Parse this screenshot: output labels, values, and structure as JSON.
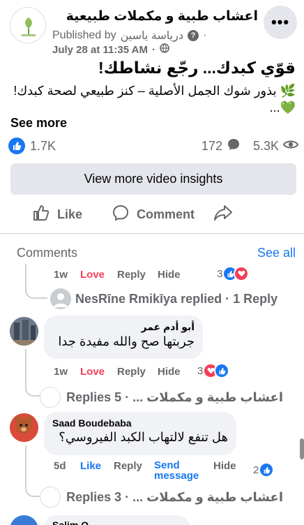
{
  "post": {
    "page_name": "اعشاب طبية و مكملات طبيعية",
    "published_by_label": "Published by",
    "published_by_name": "درياسة ياسين",
    "date": "July 28 at 11:35 AM",
    "title": "قوّي كبدك... رجّع نشاطك!",
    "body": "🌿 بذور شوك الجمل الأصلية – كنز طبيعي لصحة كبدك! 💚...",
    "see_more": "See more"
  },
  "stats": {
    "reactions": "1.7K",
    "comments": "172",
    "views": "5.3K"
  },
  "insights_button": "View more video insights",
  "actions": {
    "like": "Like",
    "comment": "Comment"
  },
  "comments_header": {
    "label": "Comments",
    "see_all": "See all"
  },
  "comments": [
    {
      "time": "1w",
      "reaction_label": "Love",
      "reply": "Reply",
      "hide": "Hide",
      "reaction_count": "3",
      "reply_by": "NesRīne Rmikīya replied · 1 Reply"
    },
    {
      "author": "أبو أدم عمر",
      "text": "جربتها صح والله مفيدة جدا",
      "time": "1w",
      "reaction_label": "Love",
      "reply": "Reply",
      "hide": "Hide",
      "reaction_count": "3",
      "replies": "اعشاب طبية و مكملات ... · 5 Replies"
    },
    {
      "author": "Saad Boudebaba",
      "text": "هل تنفع لالتهاب الكبد الفيروسي؟",
      "time": "5d",
      "reaction_label": "Like",
      "reply": "Reply",
      "send_message": "Send message",
      "hide": "Hide",
      "reaction_count": "2",
      "replies": "اعشاب طبية و مكملات ... · 3 Replies"
    }
  ],
  "next_comment_author": "Salim O..."
}
